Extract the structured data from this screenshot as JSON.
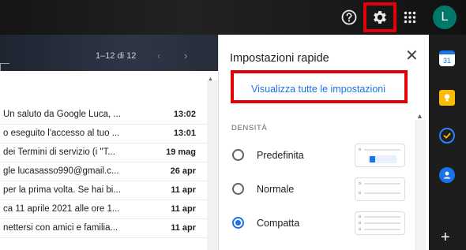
{
  "topbar": {
    "icons": [
      "help-icon",
      "gear-icon",
      "apps-grid-icon"
    ],
    "avatar_letter": "L",
    "colors": {
      "highlight": "#e3000b",
      "avatar_bg": "#00796b"
    }
  },
  "mail": {
    "pager": {
      "range": "1–12 di 12",
      "prev": "‹",
      "next": "›"
    },
    "rows": [
      {
        "snippet": "Un saluto da Google Luca, ...",
        "date": "13:02"
      },
      {
        "snippet": "o eseguito l'accesso al tuo ...",
        "date": "13:01"
      },
      {
        "snippet": "dei Termini di servizio (i \"T...",
        "date": "19 mag"
      },
      {
        "snippet": "gle lucasasso990@gmail.c...",
        "date": "26 apr"
      },
      {
        "snippet": "per la prima volta. Se hai bi...",
        "date": "11 apr"
      },
      {
        "snippet": "ca 11 aprile 2021 alle ore 1...",
        "date": "11 apr"
      },
      {
        "snippet": "nettersi con amici e familia...",
        "date": "11 apr"
      }
    ]
  },
  "quick_settings": {
    "title": "Impostazioni rapide",
    "close": "✕",
    "see_all": "Visualizza tutte le impostazioni",
    "section_density": "DENSITÀ",
    "options": [
      {
        "label": "Predefinita",
        "selected": false
      },
      {
        "label": "Normale",
        "selected": false
      },
      {
        "label": "Compatta",
        "selected": true
      }
    ],
    "accent_color": "#1a73e8"
  },
  "side_panel": {
    "icons": [
      "calendar-icon",
      "keep-icon",
      "tasks-icon",
      "contacts-icon",
      "add-icon"
    ],
    "calendar_day": "31",
    "add": "+"
  }
}
